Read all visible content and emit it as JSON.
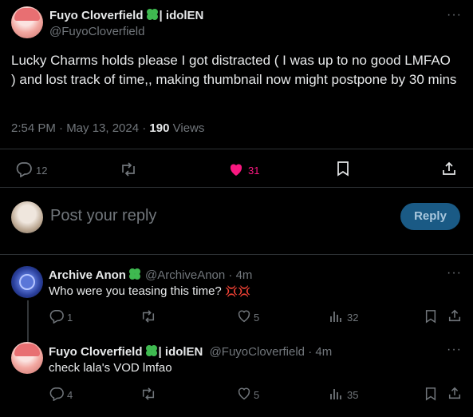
{
  "main_post": {
    "display_name": "Fuyo Cloverfield",
    "name_suffix": "| idolEN",
    "handle": "@FuyoCloverfield",
    "text": "Lucky Charms holds please I got distracted ( I was up to no good LMFAO ) and lost track of time,, making thumbnail now might postpone by 30 mins",
    "time": "2:54 PM · May 13, 2024 ·",
    "views_count": "190",
    "views_label": "Views",
    "replies": "12",
    "likes": "31",
    "like_color": "#f91880"
  },
  "reply_box": {
    "placeholder": "Post your reply",
    "button_label": "Reply",
    "button_color": "#1d9bf0"
  },
  "replies": [
    {
      "display_name": "Archive Anon",
      "handle": "@ArchiveAnon",
      "time": "· 4m",
      "text": "Who were you teasing this time?",
      "emoji": "💢💢",
      "replies": "1",
      "likes": "5",
      "views": "32"
    },
    {
      "display_name": "Fuyo Cloverfield",
      "name_suffix": "| idolEN",
      "handle": "@FuyoCloverfield",
      "time": "· 4m",
      "text": "check lala's VOD lmfao",
      "replies": "4",
      "likes": "5",
      "views": "35"
    }
  ]
}
